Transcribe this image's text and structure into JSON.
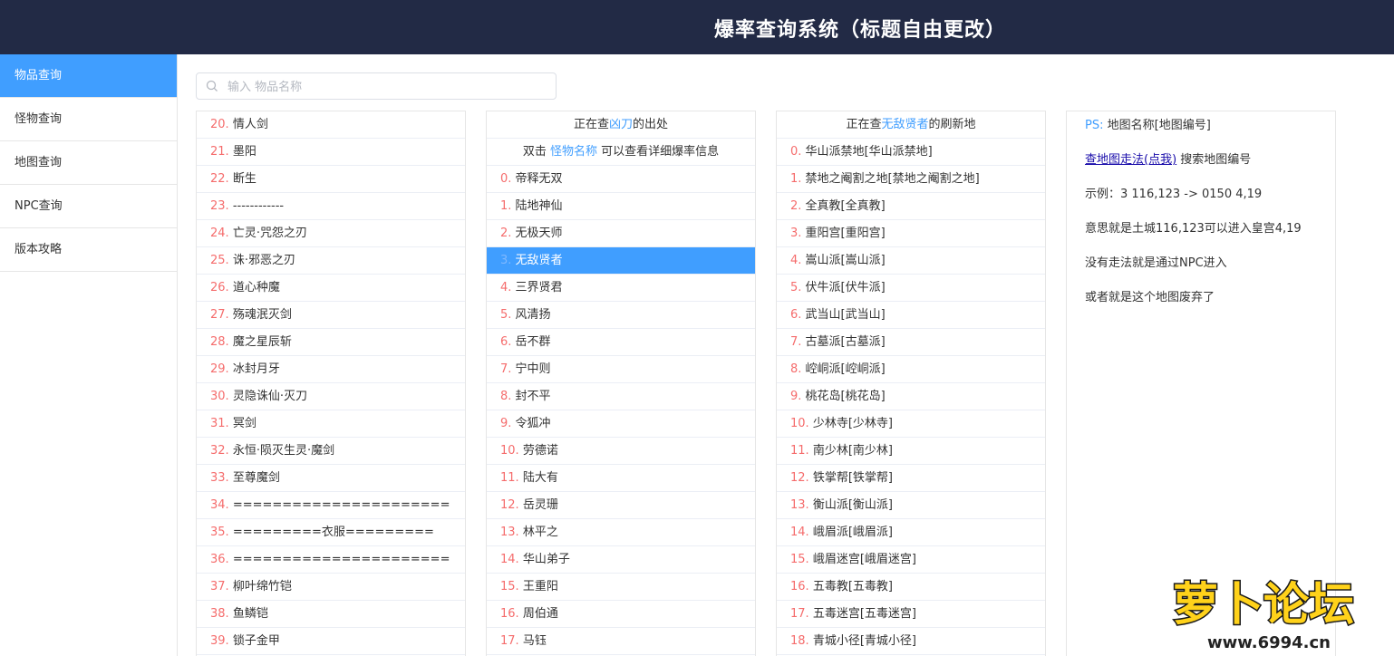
{
  "header": {
    "title": "爆率查询系统（标题自由更改）"
  },
  "sidebar": {
    "items": [
      "物品查询",
      "怪物查询",
      "地图查询",
      "NPC查询",
      "版本攻略"
    ]
  },
  "search": {
    "placeholder": "输入 物品名称",
    "value": ""
  },
  "items_list": [
    {
      "idx": "20.",
      "name": "情人剑"
    },
    {
      "idx": "21.",
      "name": "墨阳"
    },
    {
      "idx": "22.",
      "name": "断生"
    },
    {
      "idx": "23.",
      "name": "------------"
    },
    {
      "idx": "24.",
      "name": "亡灵·咒怨之刃"
    },
    {
      "idx": "25.",
      "name": "诛·邪恶之刃"
    },
    {
      "idx": "26.",
      "name": "道心种魔"
    },
    {
      "idx": "27.",
      "name": "殇魂泯灭剑"
    },
    {
      "idx": "28.",
      "name": "魔之星辰斩"
    },
    {
      "idx": "29.",
      "name": "冰封月牙"
    },
    {
      "idx": "30.",
      "name": "灵隐诛仙·灭刀"
    },
    {
      "idx": "31.",
      "name": "冥剑"
    },
    {
      "idx": "32.",
      "name": "永恒·陨灭生灵·魔剑"
    },
    {
      "idx": "33.",
      "name": "至尊魔剑"
    },
    {
      "idx": "34.",
      "name": "======================"
    },
    {
      "idx": "35.",
      "name": "=========衣服========="
    },
    {
      "idx": "36.",
      "name": "======================"
    },
    {
      "idx": "37.",
      "name": "柳叶绵竹铠"
    },
    {
      "idx": "38.",
      "name": "鱼鳞铠"
    },
    {
      "idx": "39.",
      "name": "锁子金甲"
    }
  ],
  "monsters_panel": {
    "header_prefix": "正在查",
    "header_item": "凶刀",
    "header_suffix": "的出处",
    "hint_prefix": "双击",
    "hint_link": "怪物名称",
    "hint_suffix": "可以查看详细爆率信息",
    "selected_index": 3,
    "rows": [
      {
        "idx": "0.",
        "name": "帝释无双"
      },
      {
        "idx": "1.",
        "name": "陆地神仙"
      },
      {
        "idx": "2.",
        "name": "无极天师"
      },
      {
        "idx": "3.",
        "name": "无敌贤者"
      },
      {
        "idx": "4.",
        "name": "三界贤君"
      },
      {
        "idx": "5.",
        "name": "风清扬"
      },
      {
        "idx": "6.",
        "name": "岳不群"
      },
      {
        "idx": "7.",
        "name": "宁中则"
      },
      {
        "idx": "8.",
        "name": "封不平"
      },
      {
        "idx": "9.",
        "name": "令狐冲"
      },
      {
        "idx": "10.",
        "name": "劳德诺"
      },
      {
        "idx": "11.",
        "name": "陆大有"
      },
      {
        "idx": "12.",
        "name": "岳灵珊"
      },
      {
        "idx": "13.",
        "name": "林平之"
      },
      {
        "idx": "14.",
        "name": "华山弟子"
      },
      {
        "idx": "15.",
        "name": "王重阳"
      },
      {
        "idx": "16.",
        "name": "周伯通"
      },
      {
        "idx": "17.",
        "name": "马钰"
      }
    ]
  },
  "maps_panel": {
    "header_prefix": "正在查",
    "header_item": "无敌贤者",
    "header_suffix": "的刷新地",
    "rows": [
      {
        "idx": "0.",
        "name": "华山派禁地[华山派禁地]"
      },
      {
        "idx": "1.",
        "name": "禁地之阉割之地[禁地之阉割之地]"
      },
      {
        "idx": "2.",
        "name": "全真教[全真教]"
      },
      {
        "idx": "3.",
        "name": "重阳宫[重阳宫]"
      },
      {
        "idx": "4.",
        "name": "嵩山派[嵩山派]"
      },
      {
        "idx": "5.",
        "name": "伏牛派[伏牛派]"
      },
      {
        "idx": "6.",
        "name": "武当山[武当山]"
      },
      {
        "idx": "7.",
        "name": "古墓派[古墓派]"
      },
      {
        "idx": "8.",
        "name": "崆峒派[崆峒派]"
      },
      {
        "idx": "9.",
        "name": "桃花岛[桃花岛]"
      },
      {
        "idx": "10.",
        "name": "少林寺[少林寺]"
      },
      {
        "idx": "11.",
        "name": "南少林[南少林]"
      },
      {
        "idx": "12.",
        "name": "铁掌帮[铁掌帮]"
      },
      {
        "idx": "13.",
        "name": "衡山派[衡山派]"
      },
      {
        "idx": "14.",
        "name": "峨眉派[峨眉派]"
      },
      {
        "idx": "15.",
        "name": "峨眉迷宫[峨眉迷宫]"
      },
      {
        "idx": "16.",
        "name": "五毒教[五毒教]"
      },
      {
        "idx": "17.",
        "name": "五毒迷宫[五毒迷宫]"
      },
      {
        "idx": "18.",
        "name": "青城小径[青城小径]"
      }
    ]
  },
  "info_panel": {
    "ps_label": "PS:",
    "ps_text": "地图名称[地图编号]",
    "link_text": "查地图走法(点我)",
    "link_suffix": "搜索地图编号",
    "example": "示例：3 116,123 -> 0150 4,19",
    "meaning": "意思就是土城116,123可以进入皇宫4,19",
    "no_route": "没有走法就是通过NPC进入",
    "abandoned": "或者就是这个地图废弃了"
  },
  "watermark": {
    "text": "萝卜论坛",
    "url": "www.6994.cn"
  },
  "colors": {
    "header_bg": "#222a45",
    "accent": "#409eff",
    "index_red": "#f56c6c"
  }
}
